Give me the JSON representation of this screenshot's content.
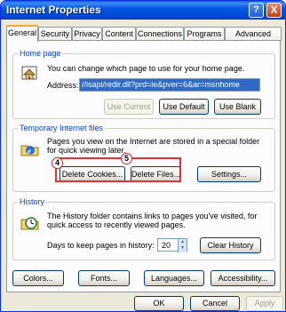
{
  "window": {
    "title": "Internet Properties"
  },
  "titlebar": {
    "help_label": "?",
    "close_label": "X"
  },
  "tabs": [
    "General",
    "Security",
    "Privacy",
    "Content",
    "Connections",
    "Programs",
    "Advanced"
  ],
  "home_page": {
    "group_label": "Home page",
    "description": "You can change which page to use for your home page.",
    "address_label": "Address:",
    "address_value": "//isapi/redir.dll?prd=ie&pver=6&ar=msnhome",
    "use_current": "Use Current",
    "use_default": "Use Default",
    "use_blank": "Use Blank"
  },
  "temp_files": {
    "group_label": "Temporary Internet files",
    "description_line1": "Pages you view on the Internet are stored in a special folder",
    "description_line2": "for quick viewing later.",
    "delete_cookies": "Delete Cookies...",
    "delete_files": "Delete Files...",
    "settings": "Settings...",
    "badge_cookies": "4",
    "badge_files": "5"
  },
  "history": {
    "group_label": "History",
    "description_line1": "The History folder contains links to pages you've visited, for",
    "description_line2": "quick access to recently viewed pages.",
    "days_label": "Days to keep pages in history:",
    "days_value": "20",
    "clear_history": "Clear History"
  },
  "bottom_buttons": {
    "colors": "Colors...",
    "fonts": "Fonts...",
    "languages": "Languages...",
    "accessibility": "Accessibility..."
  },
  "dialog_buttons": {
    "ok": "OK",
    "cancel": "Cancel",
    "apply": "Apply"
  },
  "colors": {
    "title_bar": "#0054e3",
    "highlight": "#e8302f",
    "group_label": "#0046d5"
  }
}
